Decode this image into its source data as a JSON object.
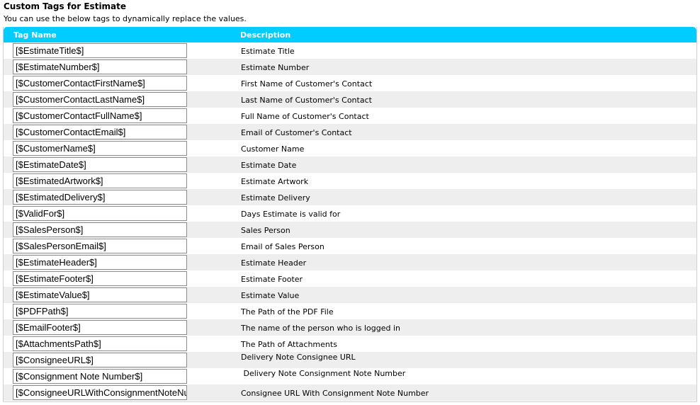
{
  "page": {
    "title": "Custom Tags for Estimate",
    "subtitle": "You can use the below tags to dynamically replace the values."
  },
  "table": {
    "header_tag_name": "Tag Name",
    "header_description": "Description",
    "header_color": "#00ccff",
    "rows": [
      {
        "tag": "[$EstimateTitle$]",
        "description": "Estimate Title"
      },
      {
        "tag": "[$EstimateNumber$]",
        "description": "Estimate Number"
      },
      {
        "tag": "[$CustomerContactFirstName$]",
        "description": "First Name of Customer's Contact"
      },
      {
        "tag": "[$CustomerContactLastName$]",
        "description": "Last Name of Customer's Contact"
      },
      {
        "tag": "[$CustomerContactFullName$]",
        "description": "Full Name of Customer's Contact"
      },
      {
        "tag": "[$CustomerContactEmail$]",
        "description": "Email of Customer's Contact"
      },
      {
        "tag": "[$CustomerName$]",
        "description": "Customer Name"
      },
      {
        "tag": "[$EstimateDate$]",
        "description": "Estimate Date"
      },
      {
        "tag": "[$EstimatedArtwork$]",
        "description": "Estimate Artwork"
      },
      {
        "tag": "[$EstimatedDelivery$]",
        "description": "Estimate Delivery"
      },
      {
        "tag": "[$ValidFor$]",
        "description": "Days Estimate is valid for"
      },
      {
        "tag": "[$SalesPerson$]",
        "description": "Sales Person"
      },
      {
        "tag": "[$SalesPersonEmail$]",
        "description": "Email of Sales Person"
      },
      {
        "tag": "[$EstimateHeader$]",
        "description": "Estimate Header"
      },
      {
        "tag": "[$EstimateFooter$]",
        "description": "Estimate Footer"
      },
      {
        "tag": "[$EstimateValue$]",
        "description": "Estimate Value"
      },
      {
        "tag": "[$PDFPath$]",
        "description": "The Path of the PDF File"
      },
      {
        "tag": "[$EmailFooter$]",
        "description": "The name of the person who is logged in"
      },
      {
        "tag": "[$AttachmentsPath$]",
        "description": "The Path of Attachments"
      },
      {
        "tag": "[$ConsigneeURL$]",
        "description": "Delivery Note Consignee URL"
      },
      {
        "tag": "[$Consignment Note Number$]",
        "description": " Delivery Note Consignment Note Number"
      },
      {
        "tag": "[$ConsigneeURLWithConsignmentNoteNumber$]",
        "description": "Consignee URL With Consignment Note Number"
      }
    ]
  }
}
